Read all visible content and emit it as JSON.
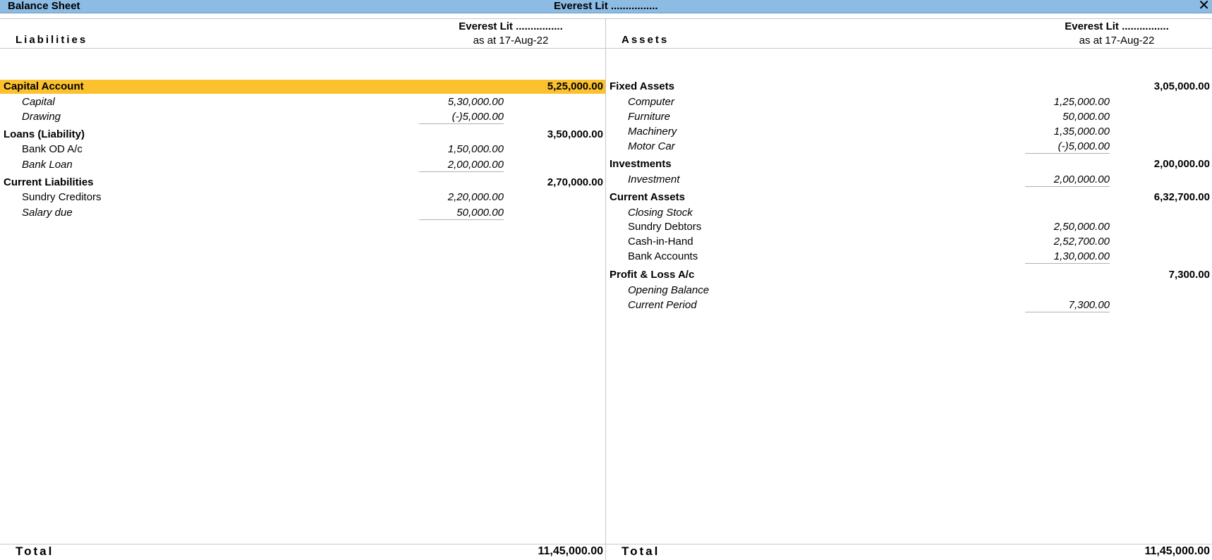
{
  "window": {
    "title": "Balance Sheet",
    "company": "Everest Lit ................",
    "close_glyph": "✕"
  },
  "liabilities": {
    "heading": "Liabilities",
    "company": "Everest Lit ................",
    "as_at": "as at 17-Aug-22",
    "groups": [
      {
        "name": "Capital Account",
        "amount": "5,25,000.00",
        "items": [
          {
            "name": "Capital",
            "amount": "5,30,000.00"
          },
          {
            "name": "Drawing",
            "amount": "(-)5,000.00"
          }
        ]
      },
      {
        "name": "Loans (Liability)",
        "amount": "3,50,000.00",
        "items": [
          {
            "name": "Bank OD A/c",
            "amount": "1,50,000.00"
          },
          {
            "name": "Bank Loan",
            "amount": "2,00,000.00"
          }
        ]
      },
      {
        "name": "Current Liabilities",
        "amount": "2,70,000.00",
        "items": [
          {
            "name": "Sundry Creditors",
            "amount": "2,20,000.00"
          },
          {
            "name": "Salary due",
            "amount": "50,000.00"
          }
        ]
      }
    ],
    "total_label": "Total",
    "total": "11,45,000.00"
  },
  "assets": {
    "heading": "Assets",
    "company": "Everest Lit ................",
    "as_at": "as at 17-Aug-22",
    "groups": [
      {
        "name": "Fixed Assets",
        "amount": "3,05,000.00",
        "items": [
          {
            "name": "Computer",
            "amount": "1,25,000.00"
          },
          {
            "name": "Furniture",
            "amount": "50,000.00"
          },
          {
            "name": "Machinery",
            "amount": "1,35,000.00"
          },
          {
            "name": "Motor Car",
            "amount": "(-)5,000.00"
          }
        ]
      },
      {
        "name": "Investments",
        "amount": "2,00,000.00",
        "items": [
          {
            "name": "Investment",
            "amount": "2,00,000.00"
          }
        ]
      },
      {
        "name": "Current Assets",
        "amount": "6,32,700.00",
        "items": [
          {
            "name": "Closing Stock",
            "amount": ""
          },
          {
            "name": "Sundry Debtors",
            "amount": "2,50,000.00"
          },
          {
            "name": "Cash-in-Hand",
            "amount": "2,52,700.00"
          },
          {
            "name": "Bank Accounts",
            "amount": "1,30,000.00"
          }
        ]
      },
      {
        "name": "Profit & Loss A/c",
        "amount": "7,300.00",
        "items": [
          {
            "name": "Opening Balance",
            "amount": ""
          },
          {
            "name": "Current Period",
            "amount": "7,300.00"
          }
        ]
      }
    ],
    "total_label": "Total",
    "total": "11,45,000.00"
  },
  "colors": {
    "titlebar": "#8cbce4",
    "highlight": "#fcc12f"
  }
}
